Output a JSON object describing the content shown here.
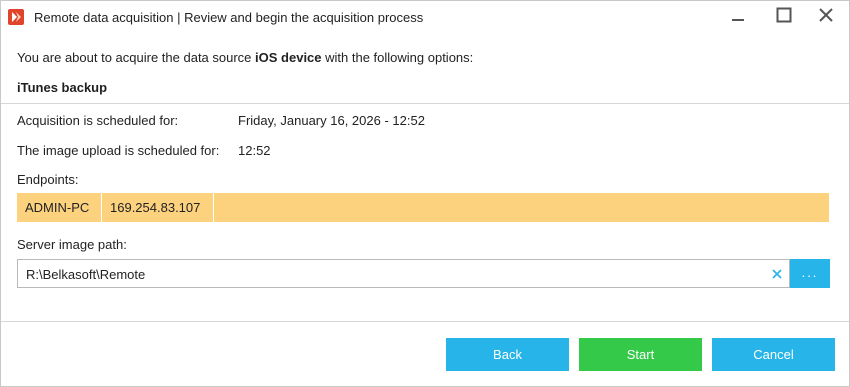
{
  "window": {
    "title": "Remote data acquisition | Review and begin the acquisition process",
    "controls": [
      "minimize-icon",
      "maximize-icon",
      "close-icon"
    ]
  },
  "intro": {
    "prefix": "You are about to acquire the data source ",
    "source": "iOS device",
    "suffix": " with the following options:"
  },
  "section_title": "iTunes backup",
  "schedule": {
    "acq_label": "Acquisition is scheduled for:",
    "acq_value": "Friday, January 16, 2026 - 12:52",
    "upload_label": "The image upload is scheduled for:",
    "upload_value": "12:52"
  },
  "endpoints": {
    "label": "Endpoints:",
    "rows": [
      {
        "name": "ADMIN-PC",
        "ip": "169.254.83.107"
      }
    ]
  },
  "server_path": {
    "label": "Server image path:",
    "value": "R:\\Belkasoft\\Remote",
    "browse_label": "..."
  },
  "buttons": {
    "back": "Back",
    "start": "Start",
    "cancel": "Cancel"
  },
  "colors": {
    "accent_blue": "#27b4e9",
    "start_green": "#35c94a",
    "endpoint_highlight": "#fcd27f",
    "app_icon_red": "#e0452b"
  }
}
